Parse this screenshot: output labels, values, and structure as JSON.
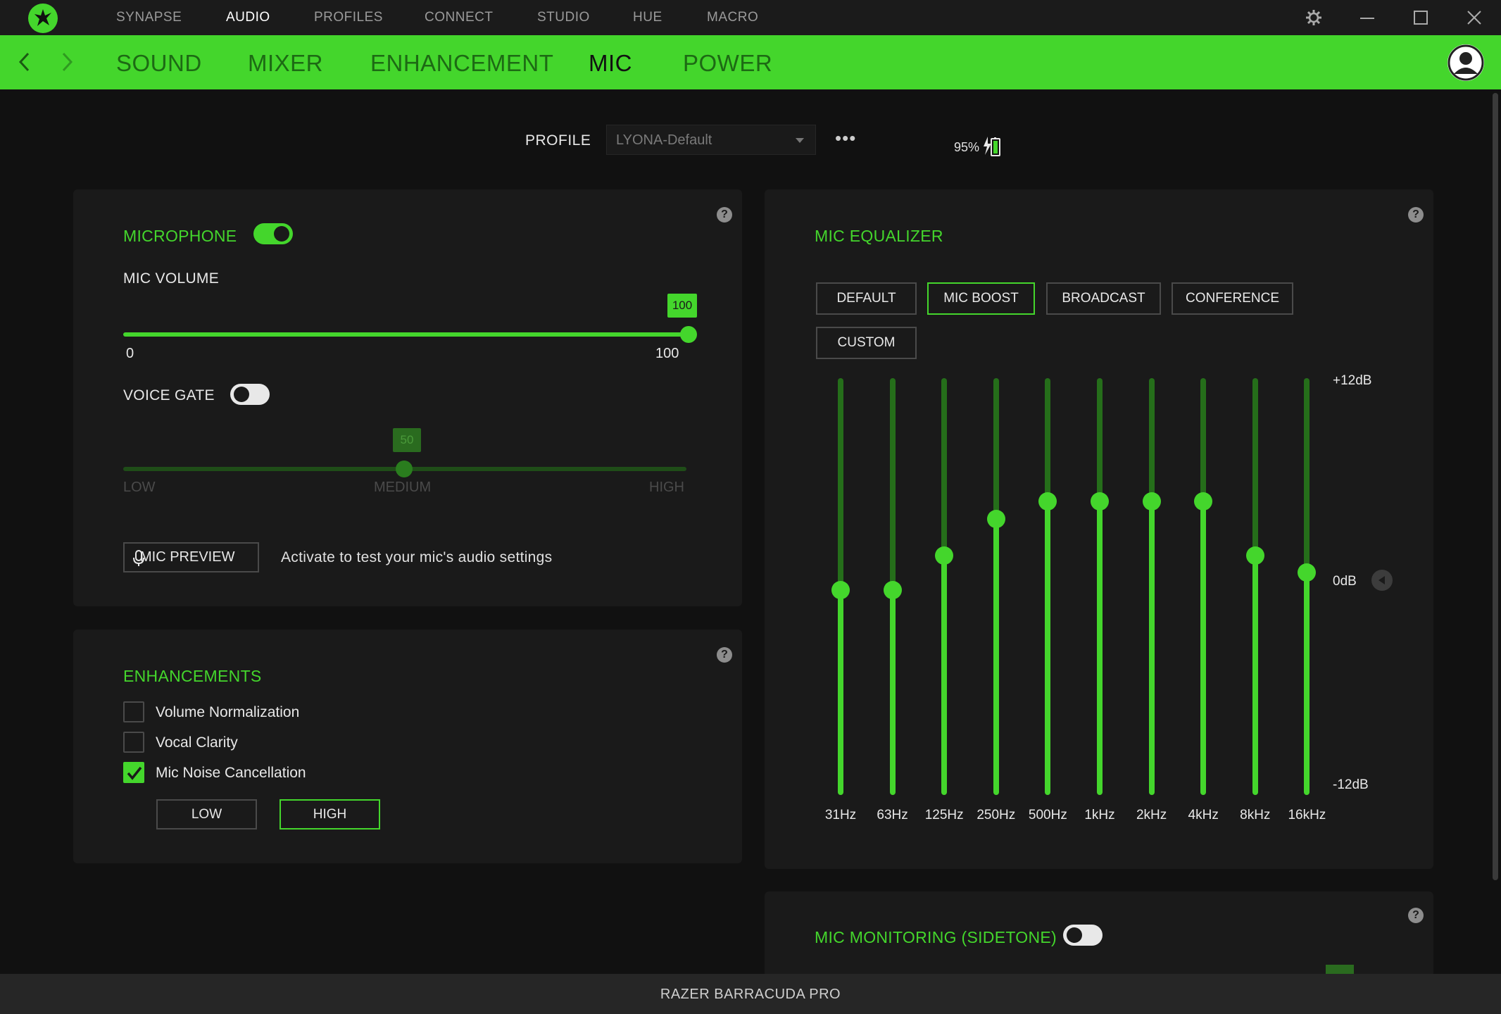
{
  "topnav": {
    "items": [
      "SYNAPSE",
      "AUDIO",
      "PROFILES",
      "CONNECT",
      "STUDIO",
      "HUE",
      "MACRO"
    ],
    "active": "AUDIO"
  },
  "subnav": {
    "items": [
      "SOUND",
      "MIXER",
      "ENHANCEMENT",
      "MIC",
      "POWER"
    ],
    "active": "MIC"
  },
  "profile": {
    "label": "PROFILE",
    "value": "LYONA-Default",
    "more": "•••",
    "battery": "95%"
  },
  "microphone": {
    "title": "MICROPHONE",
    "enabled": true,
    "volume_label": "MIC VOLUME",
    "volume_value": "100",
    "volume_min": "0",
    "volume_max": "100",
    "voice_gate_label": "VOICE GATE",
    "voice_gate_enabled": false,
    "gate_value": "50",
    "gate_low": "LOW",
    "gate_medium": "MEDIUM",
    "gate_high": "HIGH",
    "preview_button": "MIC PREVIEW",
    "preview_hint": "Activate to test your mic's audio settings"
  },
  "enhancements": {
    "title": "ENHANCEMENTS",
    "options": [
      {
        "label": "Volume Normalization",
        "checked": false
      },
      {
        "label": "Vocal Clarity",
        "checked": false
      },
      {
        "label": "Mic Noise Cancellation",
        "checked": true
      }
    ],
    "level_low": "LOW",
    "level_high": "HIGH",
    "level_selected": "HIGH"
  },
  "equalizer": {
    "title": "MIC EQUALIZER",
    "presets": [
      "DEFAULT",
      "MIC BOOST",
      "BROADCAST",
      "CONFERENCE",
      "CUSTOM"
    ],
    "selected_preset": "MIC BOOST",
    "max_label": "+12dB",
    "mid_label": "0dB",
    "min_label": "-12dB",
    "bands": [
      {
        "freq": "31Hz",
        "gain": -0.2
      },
      {
        "freq": "63Hz",
        "gain": -0.2
      },
      {
        "freq": "125Hz",
        "gain": 1.8
      },
      {
        "freq": "250Hz",
        "gain": 3.9
      },
      {
        "freq": "500Hz",
        "gain": 4.9
      },
      {
        "freq": "1kHz",
        "gain": 4.9
      },
      {
        "freq": "2kHz",
        "gain": 4.9
      },
      {
        "freq": "4kHz",
        "gain": 4.9
      },
      {
        "freq": "8kHz",
        "gain": 1.8
      },
      {
        "freq": "16kHz",
        "gain": 0.8
      }
    ]
  },
  "sidetone": {
    "title": "MIC MONITORING (SIDETONE)",
    "enabled": false
  },
  "footer": {
    "device": "RAZER BARRACUDA PRO"
  },
  "colors": {
    "accent": "#44d62c",
    "background": "#111111",
    "panel": "#1a1a1a"
  }
}
